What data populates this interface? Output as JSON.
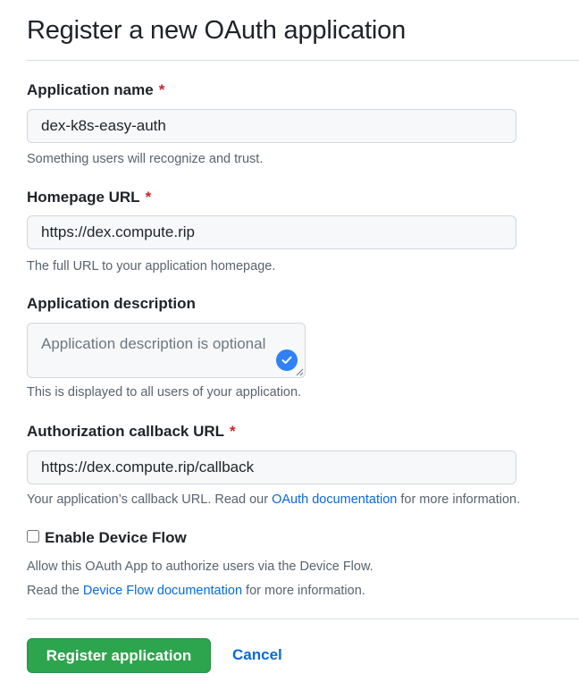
{
  "page": {
    "title": "Register a new OAuth application"
  },
  "fields": {
    "app_name": {
      "label": "Application name",
      "required_mark": "*",
      "value": "dex-k8s-easy-auth",
      "hint": "Something users will recognize and trust."
    },
    "homepage_url": {
      "label": "Homepage URL",
      "required_mark": "*",
      "value": "https://dex.compute.rip",
      "hint": "The full URL to your application homepage."
    },
    "description": {
      "label": "Application description",
      "placeholder": "Application description is optional",
      "hint": "This is displayed to all users of your application."
    },
    "callback_url": {
      "label": "Authorization callback URL",
      "required_mark": "*",
      "value": "https://dex.compute.rip/callback",
      "hint_prefix": "Your application’s callback URL. Read our ",
      "hint_link": "OAuth documentation",
      "hint_suffix": " for more information."
    }
  },
  "device_flow": {
    "label": "Enable Device Flow",
    "checked": false,
    "hint_line1": "Allow this OAuth App to authorize users via the Device Flow.",
    "hint2_prefix": "Read the ",
    "hint2_link": "Device Flow documentation",
    "hint2_suffix": " for more information."
  },
  "actions": {
    "register_label": "Register application",
    "cancel_label": "Cancel"
  },
  "icons": {
    "textarea_badge": "checkmark-circle-icon",
    "textarea_resize": "resize-handle-icon"
  },
  "colors": {
    "primary_button": "#2da44e",
    "link": "#0969da",
    "required": "#cf222e",
    "badge": "#2f81f7"
  }
}
